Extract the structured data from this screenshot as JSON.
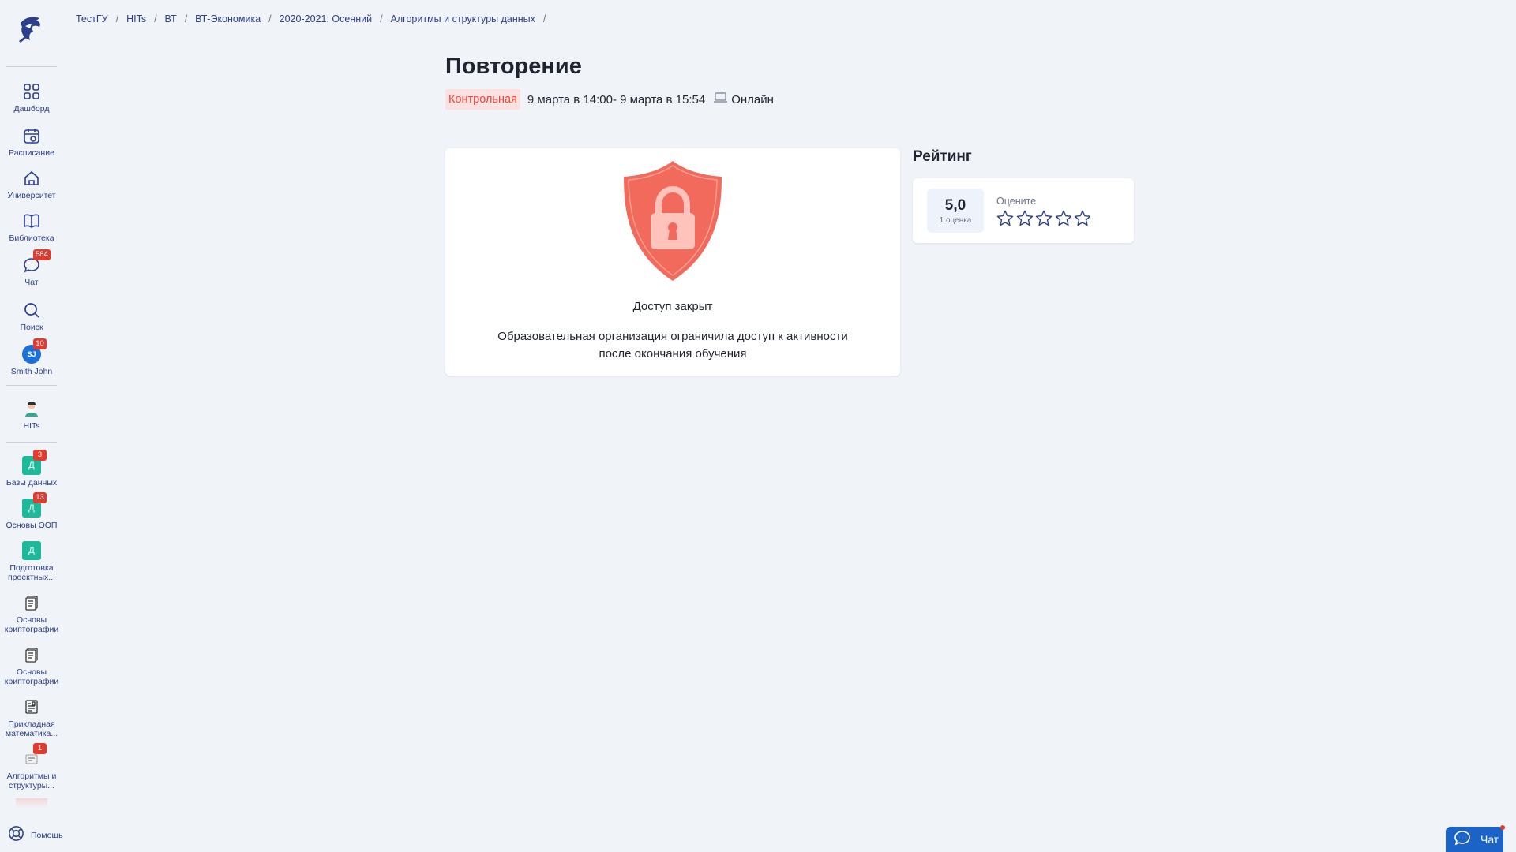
{
  "breadcrumbs": [
    "ТестГУ",
    "HITs",
    "ВТ",
    "ВТ-Экономика",
    "2020-2021: Осенний",
    "Алгоритмы и структуры данных"
  ],
  "breadcrumb_separator": "/",
  "sidebar": {
    "nav": [
      {
        "label": "Дашборд",
        "icon": "grid-icon"
      },
      {
        "label": "Расписание",
        "icon": "calendar-icon"
      },
      {
        "label": "Университет",
        "icon": "home-icon"
      },
      {
        "label": "Библиотека",
        "icon": "book-icon"
      },
      {
        "label": "Чат",
        "icon": "chat-bubble-icon",
        "badge": "584"
      },
      {
        "label": "Поиск",
        "icon": "search-icon"
      },
      {
        "label": "Smith John",
        "avatar": "SJ",
        "badge": "10"
      }
    ],
    "org": {
      "label": "HITs",
      "icon": "mascot-icon"
    },
    "courses": [
      {
        "label": "Базы данных",
        "tile": "Д",
        "badge": "3"
      },
      {
        "label": "Основы ООП",
        "tile": "Д",
        "badge": "13"
      },
      {
        "label": "Подготовка проектных...",
        "tile": "Д"
      },
      {
        "label": "Основы криптографии",
        "icon": "notebook-icon"
      },
      {
        "label": "Основы криптографии",
        "icon": "notebook-icon"
      },
      {
        "label": "Прикладная математика...",
        "icon": "document-icon"
      },
      {
        "label": "Алгоритмы и структуры...",
        "icon": "course-thumbnail-icon",
        "badge": "1"
      }
    ],
    "help_label": "Помощь"
  },
  "activity": {
    "title": "Повторение",
    "type_tag": "Контрольная",
    "date_range": "9 марта в 14:00- 9 марта в 15:54",
    "mode": "Онлайн"
  },
  "access": {
    "title": "Доступ закрыт",
    "description": "Образовательная организация ограничила доступ к активности после окончания обучения",
    "icon": "lock-shield-icon"
  },
  "rating": {
    "title": "Рейтинг",
    "score": "5,0",
    "count": "1 оценка",
    "prompt": "Оцените",
    "stars_total": 5,
    "stars_selected": 0
  },
  "chat_button": {
    "label": "Чат",
    "has_unread": true
  },
  "colors": {
    "accent": "#2c3f8c",
    "badge": "#e23a2d",
    "tag_bg": "#fde0e0",
    "tag_text": "#e8473b",
    "shield": "#f26a5b",
    "course_tile": "#1eb89a",
    "chat_button": "#1b63c7"
  }
}
